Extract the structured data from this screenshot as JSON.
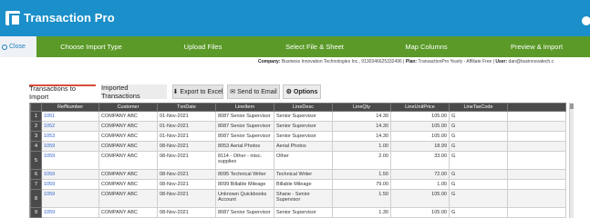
{
  "app": {
    "title": "Transaction Pro"
  },
  "steps": {
    "close_label": "Close",
    "items": [
      "Choose Import Type",
      "Upload Files",
      "Select File & Sheet",
      "Map Columns",
      "Preview & Import"
    ]
  },
  "company_info": {
    "company_key": "Company:",
    "company_value": " Business Innovation Technologies Inc., 9130346625332496 | ",
    "plan_key": "Plan:",
    "plan_value": " TransactionPro Yearly - Affiliate Free | ",
    "user_key": "User:",
    "user_value": " dan@businnovatech.c"
  },
  "tabs": {
    "active": "Transactions to Import",
    "inactive": "Imported Transactions",
    "export_label": "Export to Excel",
    "email_label": "Send to Email",
    "options_label": "Options"
  },
  "grid": {
    "columns": [
      "",
      "RefNumber",
      "Customer",
      "TxnDate",
      "LineItem",
      "LineDesc",
      "LineQty",
      "LineUnitPrice",
      "LineTaxCode",
      ""
    ],
    "rows": [
      {
        "n": "1",
        "ref": "1051",
        "cust": "COMPANY ABC",
        "date": "01-Nov-2021",
        "item": "8087 Senior Supervisor",
        "desc": "Senior Supervisor",
        "qty": "14.30",
        "price": "105.00",
        "tax": "G",
        "tall": false
      },
      {
        "n": "2",
        "ref": "1052",
        "cust": "COMPANY ABC",
        "date": "01-Nov-2021",
        "item": "8087 Senior Supervisor",
        "desc": "Senior Supervisor",
        "qty": "14.30",
        "price": "105.00",
        "tax": "G",
        "tall": false
      },
      {
        "n": "3",
        "ref": "1053",
        "cust": "COMPANY ABC",
        "date": "01-Nov-2021",
        "item": "8087 Senior Supervisor",
        "desc": "Senior Supervisor",
        "qty": "14.30",
        "price": "105.00",
        "tax": "G",
        "tall": false
      },
      {
        "n": "4",
        "ref": "1059",
        "cust": "COMPANY ABC",
        "date": "08-Nov-2021",
        "item": "8053 Aerial Photos",
        "desc": "Aerial Photos",
        "qty": "1.00",
        "price": "18.99",
        "tax": "G",
        "tall": false
      },
      {
        "n": "5",
        "ref": "1059",
        "cust": "COMPANY ABC",
        "date": "08-Nov-2021",
        "item": "8114 - Other - misc. supplies",
        "desc": "Other",
        "qty": "2.00",
        "price": "33.00",
        "tax": "G",
        "tall": true
      },
      {
        "n": "6",
        "ref": "1059",
        "cust": "COMPANY ABC",
        "date": "08-Nov-2021",
        "item": "8095 Technical Writer",
        "desc": "Technical Writer",
        "qty": "1.50",
        "price": "72.00",
        "tax": "G",
        "tall": false
      },
      {
        "n": "7",
        "ref": "1059",
        "cust": "COMPANY ABC",
        "date": "08-Nov-2021",
        "item": "8099 Billable Mileage",
        "desc": "Billable Mileage",
        "qty": "79.00",
        "price": "1.00",
        "tax": "G",
        "tall": false
      },
      {
        "n": "8",
        "ref": "1059",
        "cust": "COMPANY ABC",
        "date": "08-Nov-2021",
        "item": "Unknown Quickbooks Account",
        "desc": "Shane - Senior Supervisor",
        "qty": "1.50",
        "price": "105.00",
        "tax": "G",
        "tall": true
      },
      {
        "n": "9",
        "ref": "1059",
        "cust": "COMPANY ABC",
        "date": "08-Nov-2021",
        "item": "8087 Senior Supervisor",
        "desc": "Senior Supervisor",
        "qty": "1.30",
        "price": "105.00",
        "tax": "G",
        "tall": false
      }
    ]
  },
  "colors": {
    "header_blue": "#1a8fc9",
    "step_green": "#5b9a28",
    "tab_red": "#d94b3c",
    "grid_header": "#4a4a4a"
  },
  "icons": {
    "export": "download-arrow-icon",
    "email": "envelope-icon",
    "options": "gear-icon",
    "close": "circle-icon"
  }
}
